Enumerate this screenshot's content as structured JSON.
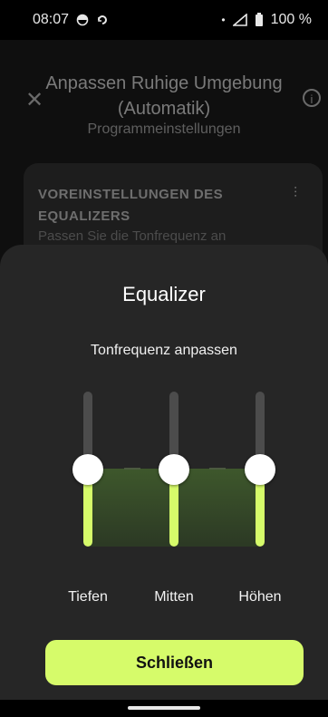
{
  "status_bar": {
    "time": "08:07",
    "battery": "100 %"
  },
  "background_screen": {
    "title": "Anpassen Ruhige Umgebung (Automatik)",
    "subtitle": "Programmeinstellungen",
    "card_heading": "VOREINSTELLUNGEN DES EQUALIZERS",
    "card_description": "Passen Sie die Tonfrequenz an"
  },
  "equalizer_sheet": {
    "title": "Equalizer",
    "subtitle": "Tonfrequenz anpassen",
    "bands": [
      {
        "label": "Tiefen",
        "level": 0.5
      },
      {
        "label": "Mitten",
        "level": 0.5
      },
      {
        "label": "Höhen",
        "level": 0.5
      }
    ],
    "close_label": "Schließen",
    "accent_color": "#d6fb6a"
  }
}
